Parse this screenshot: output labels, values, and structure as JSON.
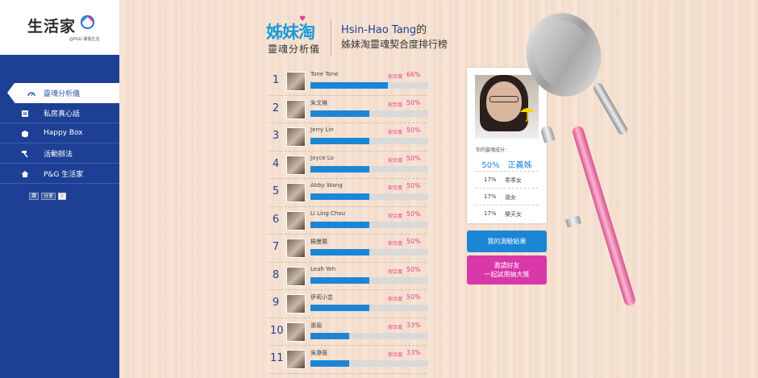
{
  "brand": {
    "logo": "生活家",
    "tagline": "@P&G 寶僑生活"
  },
  "sidebar": {
    "items": [
      {
        "label": "靈魂分析儀",
        "icon": "gauge-icon",
        "active": true
      },
      {
        "label": "私房真心話",
        "icon": "notes-icon",
        "active": false
      },
      {
        "label": "Happy Box",
        "icon": "box-icon",
        "active": false
      },
      {
        "label": "活動辦法",
        "icon": "hammer-icon",
        "active": false
      },
      {
        "label": "P&G 生活家",
        "icon": "home-icon",
        "active": false
      }
    ],
    "share": {
      "like": "讚",
      "share": "分享",
      "count": "0"
    }
  },
  "header": {
    "app_title": "姊妹淘",
    "app_subtitle": "靈魂分析儀",
    "user": "Hsin-Hao Tang",
    "user_suffix": "的",
    "subtitle": "姊妹淘靈魂契合度排行榜"
  },
  "ranking": {
    "match_label": "契合度",
    "rows": [
      {
        "rank": "1",
        "name": "Tone Tone",
        "pct": "66%",
        "value": 0.66
      },
      {
        "rank": "2",
        "name": "朱文琳",
        "pct": "50%",
        "value": 0.5
      },
      {
        "rank": "3",
        "name": "Jerry Lin",
        "pct": "50%",
        "value": 0.5
      },
      {
        "rank": "4",
        "name": "Joyce Lo",
        "pct": "50%",
        "value": 0.5
      },
      {
        "rank": "5",
        "name": "Abby Wang",
        "pct": "50%",
        "value": 0.5
      },
      {
        "rank": "6",
        "name": "Li Ling Chou",
        "pct": "50%",
        "value": 0.5
      },
      {
        "rank": "7",
        "name": "楊曼蘭",
        "pct": "50%",
        "value": 0.5
      },
      {
        "rank": "8",
        "name": "Leah Yeh",
        "pct": "50%",
        "value": 0.5
      },
      {
        "rank": "9",
        "name": "伊莉小芸",
        "pct": "50%",
        "value": 0.5
      },
      {
        "rank": "10",
        "name": "張瑜",
        "pct": "33%",
        "value": 0.33
      },
      {
        "rank": "11",
        "name": "吳瀞茵",
        "pct": "33%",
        "value": 0.33
      }
    ]
  },
  "profile": {
    "label": "你的靈魂成分：",
    "main_pct": "50%",
    "main_type": "正義姊",
    "sections": [
      {
        "pct": "17%",
        "name": "乖乖女"
      },
      {
        "pct": "17%",
        "name": "淑女"
      },
      {
        "pct": "17%",
        "name": "樂天女"
      }
    ]
  },
  "buttons": {
    "result": "我的測驗結果",
    "invite_line1": "邀請好友",
    "invite_line2": "一起試用抽大獎"
  },
  "colors": {
    "sidebar": "#1d3f94",
    "bar_fill": "#1b86d6",
    "accent_pink": "#e83f8f",
    "button_pink": "#d838a8"
  }
}
